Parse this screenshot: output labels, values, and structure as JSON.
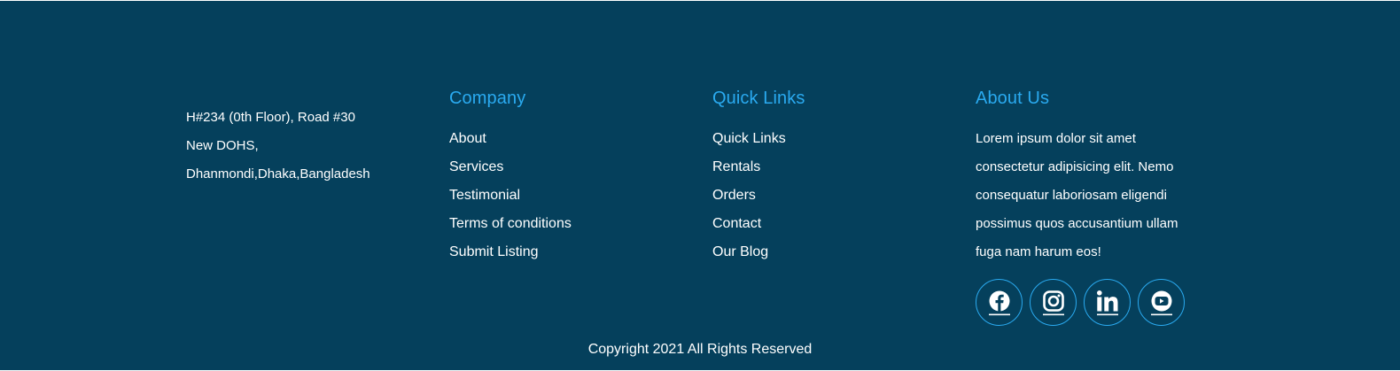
{
  "colors": {
    "background": "#05405c",
    "accent": "#2aaaf0",
    "text": "#ffffff"
  },
  "address": {
    "line1": "H#234 (0th Floor), Road #30",
    "line2": "New DOHS,",
    "line3": "Dhanmondi,Dhaka,Bangladesh"
  },
  "company": {
    "title": "Company",
    "items": [
      "About",
      "Services",
      "Testimonial",
      "Terms of conditions",
      "Submit Listing"
    ]
  },
  "quick_links": {
    "title": "Quick Links",
    "items": [
      "Quick Links",
      "Rentals",
      "Orders",
      "Contact",
      "Our Blog"
    ]
  },
  "about": {
    "title": "About Us",
    "text": "Lorem ipsum dolor sit amet consectetur adipisicing elit. Nemo consequatur laboriosam eligendi possimus quos accusantium ullam fuga nam harum eos!"
  },
  "socials": [
    "facebook-icon",
    "instagram-icon",
    "linkedin-icon",
    "youtube-icon"
  ],
  "copyright": "Copyright 2021 All Rights Reserved"
}
